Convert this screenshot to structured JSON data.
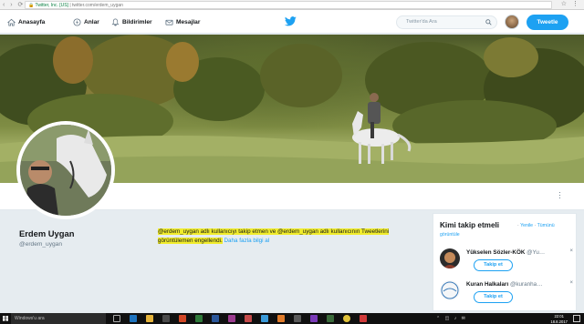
{
  "browser": {
    "secure_label": "Twitter, Inc. [US]",
    "url": "twitter.com/erdem_uygan"
  },
  "nav": {
    "items": [
      {
        "label": "Anasayfa",
        "icon": "home-icon"
      },
      {
        "label": "Anlar",
        "icon": "lightning-icon"
      },
      {
        "label": "Bildirimler",
        "icon": "bell-icon"
      },
      {
        "label": "Mesajlar",
        "icon": "envelope-icon"
      }
    ],
    "logo": "twitter-bird-icon",
    "search_placeholder": "Twitter'da Ara",
    "tweet_button": "Tweetle"
  },
  "profile": {
    "name": "Erdem Uygan",
    "handle": "@erdem_uygan",
    "blocked_message": "@erdem_uygan adlı kullanıcıyı takip etmen ve @erdem_uygan adlı kullanıcının Tweetlerini görüntülemen engellendi.",
    "learn_more": "Daha fazla bilgi al"
  },
  "who_to_follow": {
    "title": "Kimi takip etmeli",
    "refresh": "Yenile",
    "view_all": "Tümünü görüntüle",
    "separator": "·",
    "accounts": [
      {
        "name": "Yükselen Sözler-KÖK",
        "handle": "@Yu…",
        "button": "Takip et"
      },
      {
        "name": "Kuran Halkaları",
        "handle": "@kuranha…",
        "button": "Takip et"
      }
    ],
    "close": "×"
  },
  "taskbar": {
    "search_placeholder": "Windows'u ara",
    "time": "22:01",
    "date": "18.8.2017"
  },
  "colors": {
    "accent": "#1da1f2",
    "highlight": "#f1ec2c",
    "background": "#e6ecf0"
  }
}
